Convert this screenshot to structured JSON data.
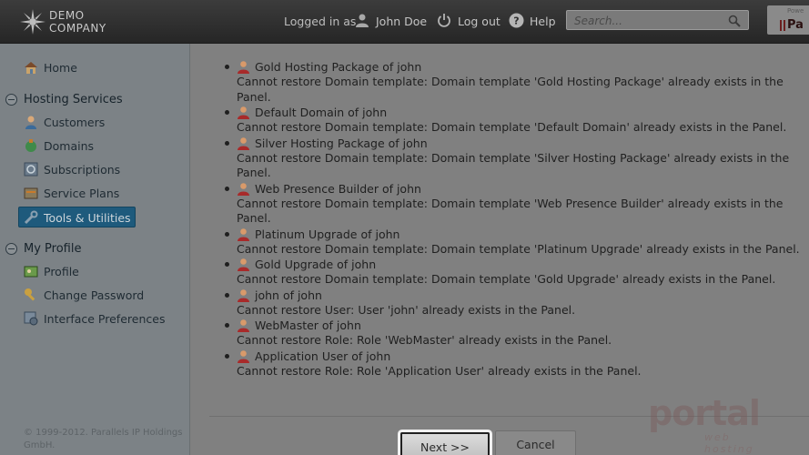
{
  "header": {
    "logo_line1": "DEMO",
    "logo_line2": "COMPANY",
    "logged_in_as": "Logged in as",
    "user_name": "John Doe",
    "logout": "Log out",
    "help": "Help",
    "search_placeholder": "Search...",
    "powered_top": "Powe",
    "powered_name": "Pa"
  },
  "sidebar": {
    "home": "Home",
    "hosting_section": "Hosting Services",
    "hosting_items": [
      "Customers",
      "Domains",
      "Subscriptions",
      "Service Plans",
      "Tools & Utilities"
    ],
    "profile_section": "My Profile",
    "profile_items": [
      "Profile",
      "Change Password",
      "Interface Preferences"
    ],
    "footer": "© 1999-2012. Parallels IP Holdings GmbH."
  },
  "entries": [
    {
      "title": "Gold Hosting Package of john",
      "message": "Cannot restore Domain template: Domain template 'Gold Hosting Package' already exists in the Panel."
    },
    {
      "title": "Default Domain of john",
      "message": "Cannot restore Domain template: Domain template 'Default Domain' already exists in the Panel."
    },
    {
      "title": "Silver Hosting Package of john",
      "message": "Cannot restore Domain template: Domain template 'Silver Hosting Package' already exists in the Panel."
    },
    {
      "title": "Web Presence Builder of john",
      "message": "Cannot restore Domain template: Domain template 'Web Presence Builder' already exists in the Panel."
    },
    {
      "title": "Platinum Upgrade of john",
      "message": "Cannot restore Domain template: Domain template 'Platinum Upgrade' already exists in the Panel."
    },
    {
      "title": "Gold Upgrade of john",
      "message": "Cannot restore Domain template: Domain template 'Gold Upgrade' already exists in the Panel."
    },
    {
      "title": "john of john",
      "message": "Cannot restore User: User 'john' already exists in the Panel."
    },
    {
      "title": "WebMaster of john",
      "message": "Cannot restore Role: Role 'WebMaster' already exists in the Panel."
    },
    {
      "title": "Application User of john",
      "message": "Cannot restore Role: Role 'Application User' already exists in the Panel."
    }
  ],
  "buttons": {
    "next": "Next >>",
    "cancel": "Cancel"
  },
  "watermark": {
    "main": "portal",
    "sub": "web hosting"
  },
  "colors": {
    "active_nav": "#1e5a7c",
    "header_bg": "#2f2f2f",
    "sidebar_bg": "#7c8286"
  }
}
